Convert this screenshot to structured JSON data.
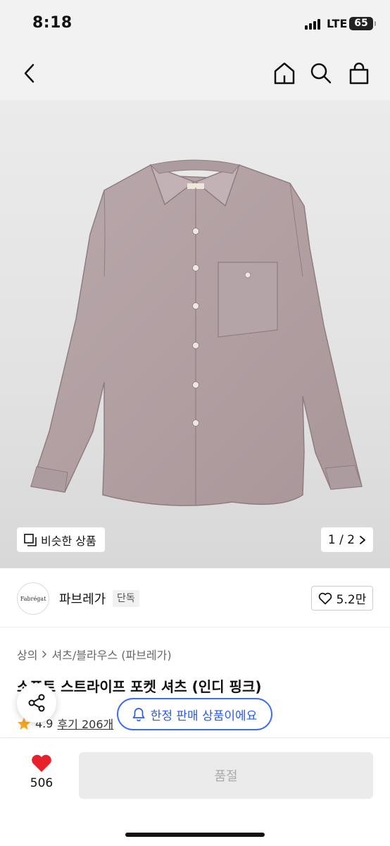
{
  "status_bar": {
    "time": "8:18",
    "network": "LTE",
    "battery": "65"
  },
  "nav": {
    "back_icon": "chevron-left-icon",
    "home_icon": "home-icon",
    "search_icon": "search-icon",
    "cart_icon": "shopping-bag-icon"
  },
  "hero": {
    "similar_label": "비슷한 상품",
    "page_current": "1",
    "page_total": "2",
    "page_display": "1 / 2"
  },
  "brand": {
    "logo_text": "Fabrégat",
    "name": "파브레가",
    "badge": "단독",
    "likes": "5.2만"
  },
  "product": {
    "breadcrumb": [
      "상의",
      "셔츠/블라우스 (파브레가)"
    ],
    "title": "소프트 스트라이프 포켓 셔츠 (인디 핑크)",
    "rating": "4.9",
    "reviews": "후기 206개"
  },
  "overlay": {
    "limited_text": "한정 판매 상품이에요"
  },
  "bottom": {
    "heart_count": "506",
    "buy_label": "품절"
  },
  "colors": {
    "accent_blue": "#3b6cf6",
    "heart_red": "#e8202a",
    "star": "#f5a623",
    "shirt": "#b3a2a5"
  }
}
